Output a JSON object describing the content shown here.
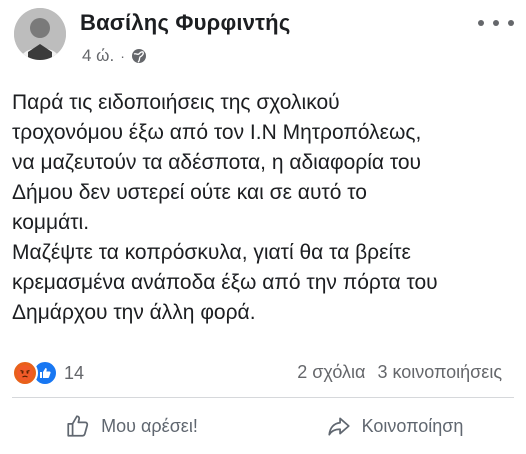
{
  "post": {
    "author": "Βασίλης Φυρφιντής",
    "time": "4 ώ.",
    "separator": "·",
    "privacy_icon": "globe-icon",
    "more_icon": "more-options-icon",
    "text_lines": [
      "Παρά τις ειδοποιήσεις της σχολικού",
      "τροχονόμου έξω από τον Ι.Ν Μητροπόλεως,",
      "να μαζευτούν τα αδέσποτα, η αδιαφορία του",
      "Δήμου δεν υστερεί ούτε και σε αυτό το",
      "κομμάτι.",
      "Μαζέψτε τα κοπρόσκυλα, γιατί θα τα βρείτε",
      "κρεμασμένα ανάποδα έξω από την πόρτα του",
      "Δημάρχου την άλλη φορά."
    ]
  },
  "reactions": {
    "icons": [
      "angry-reaction-icon",
      "like-reaction-icon"
    ],
    "count": "14",
    "comments": "2 σχόλια",
    "shares": "3 κοινοποιήσεις"
  },
  "actions": {
    "like_label": "Μου αρέσει!",
    "share_label": "Κοινοποίηση"
  },
  "colors": {
    "text": "#1c1e21",
    "secondary": "#65676b",
    "like_blue": "#1877f2",
    "angry_orange": "#e8611a"
  }
}
